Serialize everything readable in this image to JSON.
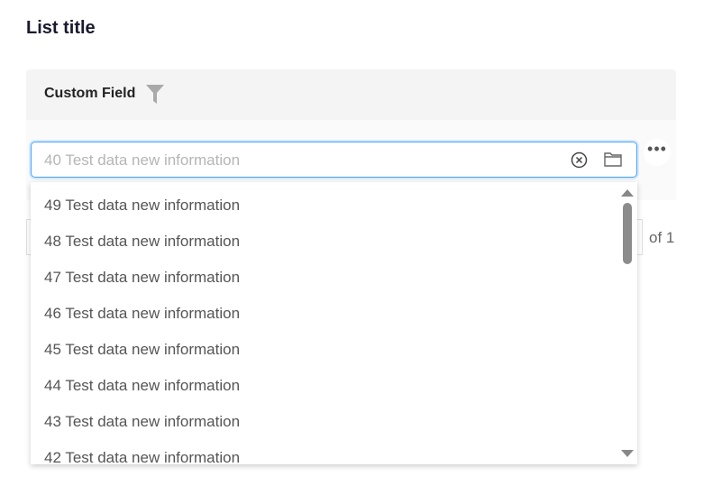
{
  "title": "List title",
  "column": {
    "label": "Custom Field",
    "filter_icon": "filter-icon"
  },
  "field": {
    "placeholder": "40 Test data new information"
  },
  "more_label": "•••",
  "pager": {
    "of_label": "of 1"
  },
  "options": [
    "49 Test data new information",
    "48 Test data new information",
    "47 Test data new information",
    "46 Test data new information",
    "45 Test data new information",
    "44 Test data new information",
    "43 Test data new information",
    "42 Test data new information"
  ]
}
